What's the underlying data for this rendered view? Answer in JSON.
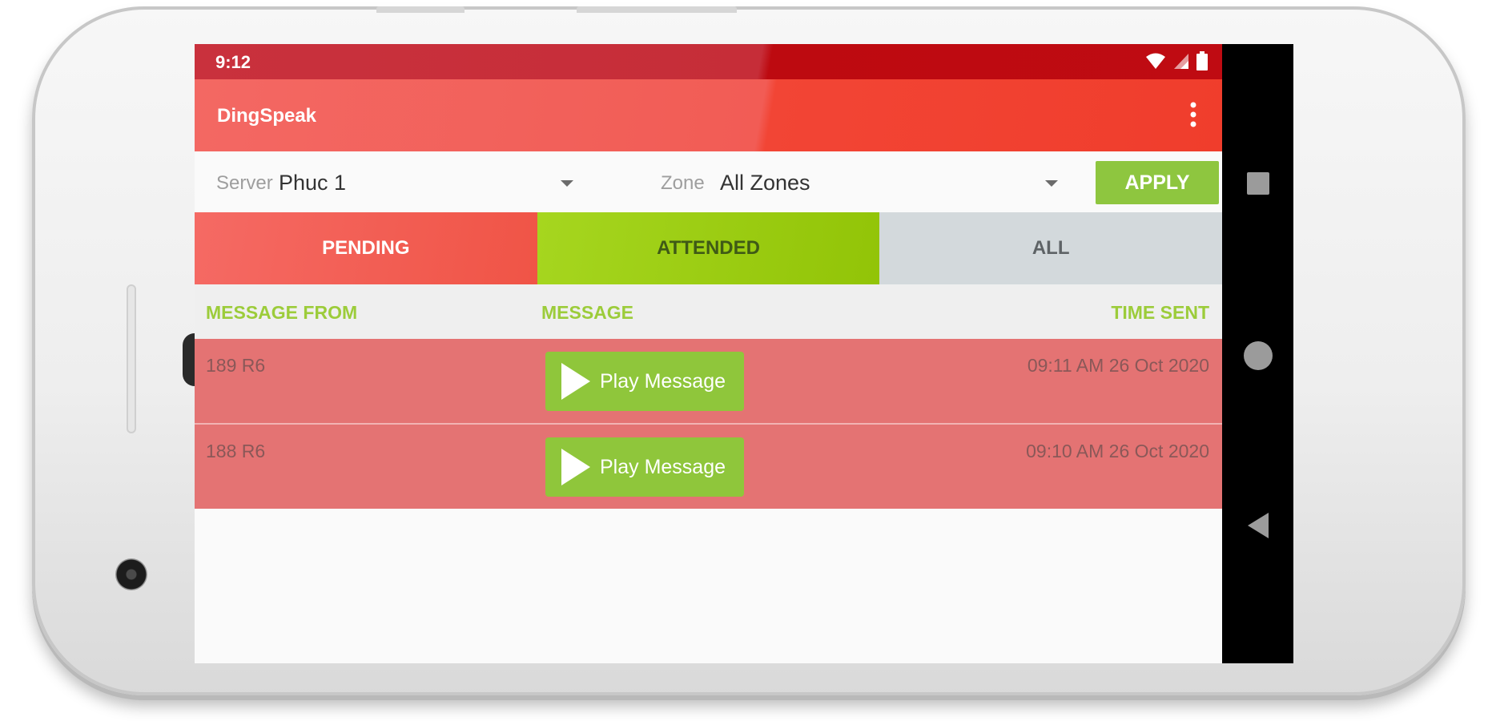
{
  "status_bar": {
    "time": "9:12",
    "icons": [
      "wifi-icon",
      "signal-icon",
      "battery-icon"
    ]
  },
  "app_bar": {
    "title": "DingSpeak",
    "menu_icon": "more-vert-icon"
  },
  "filters": {
    "server_label": "Server",
    "server_value": "Phuc 1",
    "zone_label": "Zone",
    "zone_value": "All Zones",
    "apply_label": "APPLY"
  },
  "tabs": [
    {
      "label": "PENDING",
      "color": "#f05446"
    },
    {
      "label": "ATTENDED",
      "color": "#92c407"
    },
    {
      "label": "ALL",
      "color": "#d3d9dc"
    }
  ],
  "table": {
    "columns": [
      "MESSAGE FROM",
      "MESSAGE",
      "TIME SENT"
    ],
    "rows": [
      {
        "from": "189 R6",
        "action": "Play Message",
        "time": "09:11 AM 26 Oct 2020"
      },
      {
        "from": "188 R6",
        "action": "Play Message",
        "time": "09:10 AM 26 Oct 2020"
      }
    ]
  },
  "nav_bar": {
    "icons": [
      "recents-icon",
      "home-icon",
      "back-icon"
    ]
  },
  "colors": {
    "primary": "#f24535",
    "accent": "#8ec63f",
    "row_pending": "#e47373"
  }
}
